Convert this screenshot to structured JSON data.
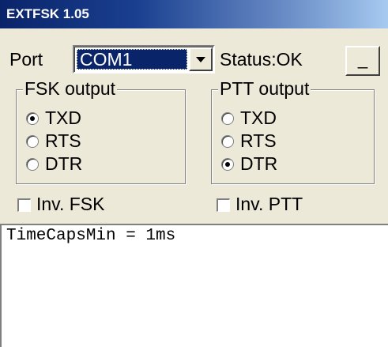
{
  "window": {
    "title": "EXTFSK 1.05"
  },
  "port": {
    "label": "Port",
    "selected": "COM1"
  },
  "status": {
    "text": "Status:OK"
  },
  "minimize_button": {
    "label": "_"
  },
  "fsk_output": {
    "legend": "FSK output",
    "options": [
      {
        "label": "TXD",
        "selected": true
      },
      {
        "label": "RTS",
        "selected": false
      },
      {
        "label": "DTR",
        "selected": false
      }
    ]
  },
  "ptt_output": {
    "legend": "PTT output",
    "options": [
      {
        "label": "TXD",
        "selected": false
      },
      {
        "label": "RTS",
        "selected": false
      },
      {
        "label": "DTR",
        "selected": true
      }
    ]
  },
  "inv_fsk": {
    "label": "Inv. FSK",
    "checked": false
  },
  "inv_ptt": {
    "label": "Inv. PTT",
    "checked": false
  },
  "log": {
    "text": "TimeCapsMin = 1ms"
  }
}
